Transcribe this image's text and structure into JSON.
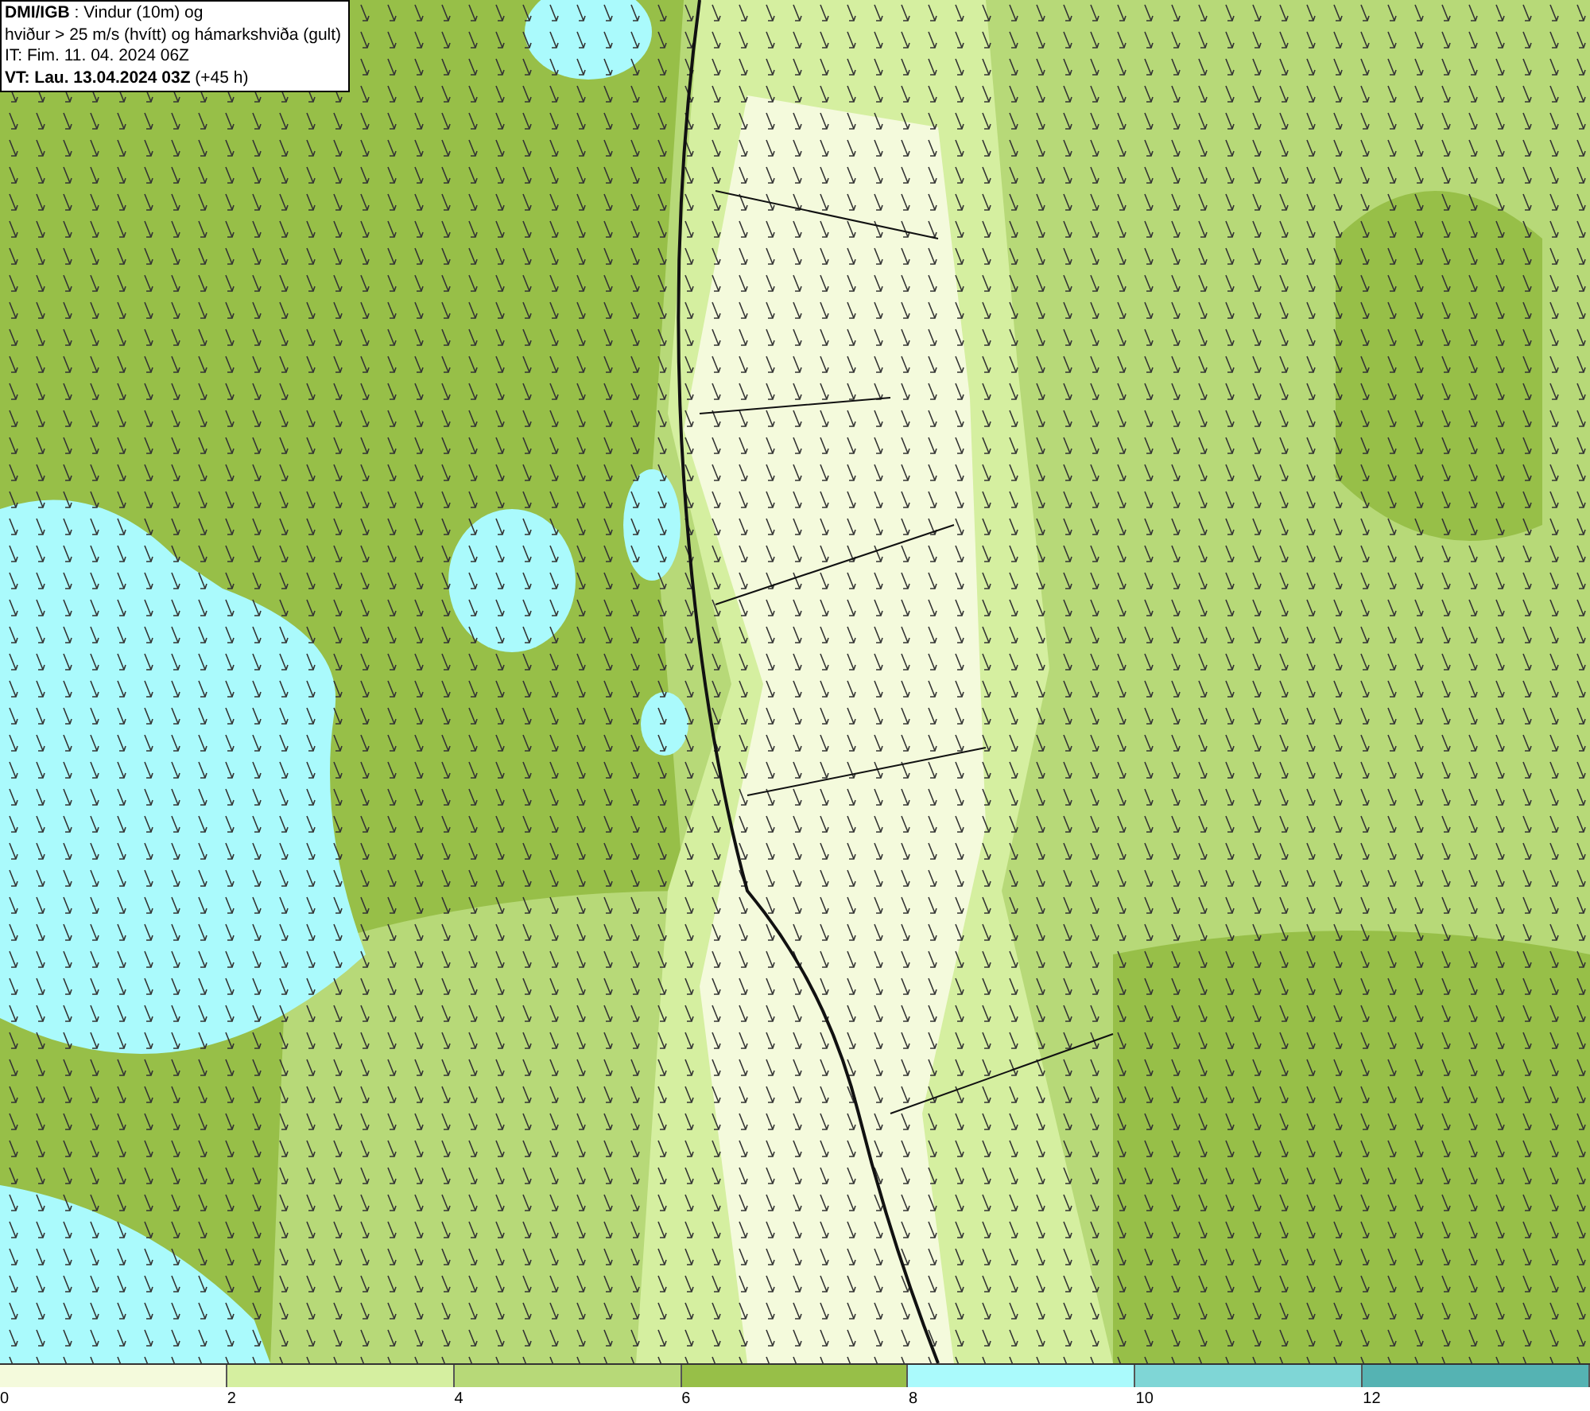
{
  "header": {
    "lines": [
      {
        "text": "**DMI/IGB** : Vindur (10m) og"
      },
      {
        "text": "hviður > 25 m/s (hvítt) og hámarkshviða (gult)"
      },
      {
        "text": "IT: Fim. 11. 04. 2024 06Z"
      },
      {
        "text": "**VT: Lau. 13.04.2024 03Z** (+45 h)"
      }
    ]
  },
  "legend": {
    "bins": [
      {
        "color": "#f4fadc",
        "label": "0"
      },
      {
        "color": "#d5efa0",
        "label": "2"
      },
      {
        "color": "#b7d978",
        "label": "4"
      },
      {
        "color": "#97bf48",
        "label": "6"
      },
      {
        "color": "#aafafc",
        "label": "8"
      },
      {
        "color": "#7fd6d6",
        "label": "10"
      },
      {
        "color": "#55b3b3",
        "label": "12"
      }
    ]
  }
}
